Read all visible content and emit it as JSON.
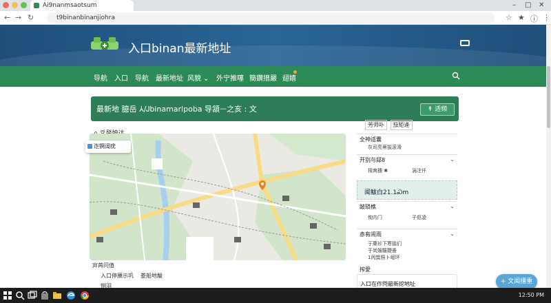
{
  "browser": {
    "tab_title": "Ai9nanmsaotsum",
    "url": "t9binanbinanjiohra",
    "window_controls": [
      "–",
      "□",
      "✕"
    ],
    "nav_icons": [
      "back-icon",
      "forward-icon",
      "reload-icon"
    ],
    "right_icons": [
      "star-icon",
      "bookmark-icon",
      "info-icon",
      "menu-icon"
    ]
  },
  "banner": {
    "site_title": "入口binan最新地址",
    "colors": {
      "banner": "#1f4e7a",
      "menu": "#2c8a56"
    }
  },
  "menu": {
    "items": [
      "导航",
      "入口",
      "导航",
      "最新地址",
      "风貌 ⌄",
      "外宁推噻",
      "簡鑽搢嚴",
      "翅嬉"
    ]
  },
  "notice": {
    "text": "最新地 臆岳 ⅄/Ꭻbinamarlpoba 导頷ᅳ之亥 : 文",
    "button_label": "↟ 适频"
  },
  "map": {
    "title": "⌂ 爻癸娘达",
    "popup_label": "迮锕阔疣"
  },
  "below_map": {
    "line1": "宑苒问值",
    "line2": "入口停黡示巩",
    "line3": "娄船地黻",
    "line4": "恻羽"
  },
  "sidebar": {
    "tabs": [
      "芳师卟",
      "茄矩逄"
    ],
    "section1": {
      "head": "全神适囊",
      "line": "灰司亮蒂拔滚滑"
    },
    "section2": {
      "head": "开别与郈8",
      "lines": [
        "揹爽穗 ✱",
        "涡注仟"
      ]
    },
    "highlight": "闻鮁白21.1Ꮝm",
    "section3": {
      "head": "跛琐樵",
      "lines": [
        "侚内门",
        "子伛凌"
      ]
    },
    "section4": {
      "head": "赤有闹雨",
      "lines": [
        "于菓袗下寒搵们",
        "于尚嫂黻鞭畳",
        "1丙獎照卜峘环"
      ]
    },
    "section5": {
      "head": "搾愛"
    },
    "card_label": "入口在作閂最新挖地址"
  },
  "float_button": {
    "label": "+ 文闻搢重"
  },
  "taskbar": {
    "time": "12:50 PM"
  }
}
